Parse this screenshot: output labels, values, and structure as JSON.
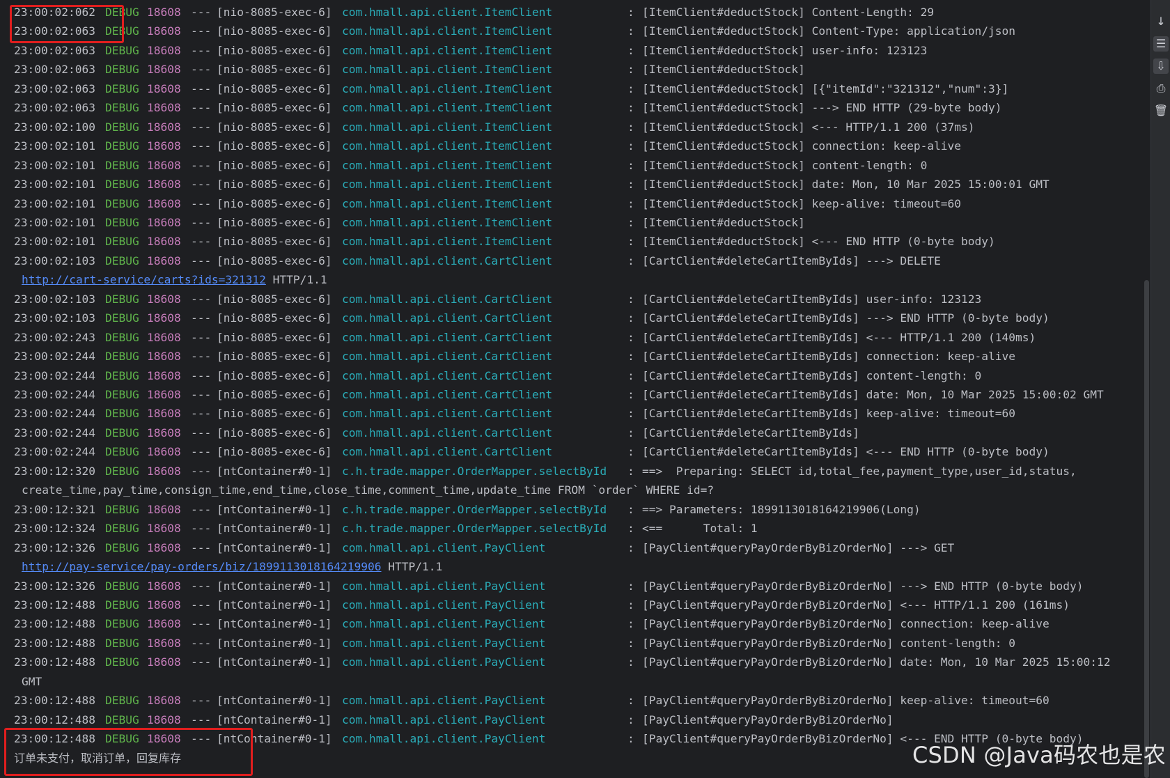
{
  "log_lines": [
    {
      "kind": "log",
      "ts": "23:00:02:062",
      "level": "DEBUG",
      "pid": "18608",
      "sep": "---",
      "thread": "[nio-8085-exec-6]",
      "logger": "com.hmall.api.client.ItemClient",
      "colon": ":",
      "message": "[ItemClient#deductStock] Content-Length: 29"
    },
    {
      "kind": "log",
      "ts": "23:00:02:063",
      "level": "DEBUG",
      "pid": "18608",
      "sep": "---",
      "thread": "[nio-8085-exec-6]",
      "logger": "com.hmall.api.client.ItemClient",
      "colon": ":",
      "message": "[ItemClient#deductStock] Content-Type: application/json"
    },
    {
      "kind": "log",
      "ts": "23:00:02:063",
      "level": "DEBUG",
      "pid": "18608",
      "sep": "---",
      "thread": "[nio-8085-exec-6]",
      "logger": "com.hmall.api.client.ItemClient",
      "colon": ":",
      "message": "[ItemClient#deductStock] user-info: 123123"
    },
    {
      "kind": "log",
      "ts": "23:00:02:063",
      "level": "DEBUG",
      "pid": "18608",
      "sep": "---",
      "thread": "[nio-8085-exec-6]",
      "logger": "com.hmall.api.client.ItemClient",
      "colon": ":",
      "message": "[ItemClient#deductStock]"
    },
    {
      "kind": "log",
      "ts": "23:00:02:063",
      "level": "DEBUG",
      "pid": "18608",
      "sep": "---",
      "thread": "[nio-8085-exec-6]",
      "logger": "com.hmall.api.client.ItemClient",
      "colon": ":",
      "message": "[ItemClient#deductStock] [{\"itemId\":\"321312\",\"num\":3}]"
    },
    {
      "kind": "log",
      "ts": "23:00:02:063",
      "level": "DEBUG",
      "pid": "18608",
      "sep": "---",
      "thread": "[nio-8085-exec-6]",
      "logger": "com.hmall.api.client.ItemClient",
      "colon": ":",
      "message": "[ItemClient#deductStock] ---> END HTTP (29-byte body)"
    },
    {
      "kind": "log",
      "ts": "23:00:02:100",
      "level": "DEBUG",
      "pid": "18608",
      "sep": "---",
      "thread": "[nio-8085-exec-6]",
      "logger": "com.hmall.api.client.ItemClient",
      "colon": ":",
      "message": "[ItemClient#deductStock] <--- HTTP/1.1 200 (37ms)"
    },
    {
      "kind": "log",
      "ts": "23:00:02:101",
      "level": "DEBUG",
      "pid": "18608",
      "sep": "---",
      "thread": "[nio-8085-exec-6]",
      "logger": "com.hmall.api.client.ItemClient",
      "colon": ":",
      "message": "[ItemClient#deductStock] connection: keep-alive"
    },
    {
      "kind": "log",
      "ts": "23:00:02:101",
      "level": "DEBUG",
      "pid": "18608",
      "sep": "---",
      "thread": "[nio-8085-exec-6]",
      "logger": "com.hmall.api.client.ItemClient",
      "colon": ":",
      "message": "[ItemClient#deductStock] content-length: 0"
    },
    {
      "kind": "log",
      "ts": "23:00:02:101",
      "level": "DEBUG",
      "pid": "18608",
      "sep": "---",
      "thread": "[nio-8085-exec-6]",
      "logger": "com.hmall.api.client.ItemClient",
      "colon": ":",
      "message": "[ItemClient#deductStock] date: Mon, 10 Mar 2025 15:00:01 GMT"
    },
    {
      "kind": "log",
      "ts": "23:00:02:101",
      "level": "DEBUG",
      "pid": "18608",
      "sep": "---",
      "thread": "[nio-8085-exec-6]",
      "logger": "com.hmall.api.client.ItemClient",
      "colon": ":",
      "message": "[ItemClient#deductStock] keep-alive: timeout=60"
    },
    {
      "kind": "log",
      "ts": "23:00:02:101",
      "level": "DEBUG",
      "pid": "18608",
      "sep": "---",
      "thread": "[nio-8085-exec-6]",
      "logger": "com.hmall.api.client.ItemClient",
      "colon": ":",
      "message": "[ItemClient#deductStock]"
    },
    {
      "kind": "log",
      "ts": "23:00:02:101",
      "level": "DEBUG",
      "pid": "18608",
      "sep": "---",
      "thread": "[nio-8085-exec-6]",
      "logger": "com.hmall.api.client.ItemClient",
      "colon": ":",
      "message": "[ItemClient#deductStock] <--- END HTTP (0-byte body)"
    },
    {
      "kind": "log",
      "ts": "23:00:02:103",
      "level": "DEBUG",
      "pid": "18608",
      "sep": "---",
      "thread": "[nio-8085-exec-6]",
      "logger": "com.hmall.api.client.CartClient",
      "colon": ":",
      "message": "[CartClient#deleteCartItemByIds] ---> DELETE"
    },
    {
      "kind": "url",
      "url": "http://cart-service/carts?ids=321312",
      "suffix": " HTTP/1.1"
    },
    {
      "kind": "log",
      "ts": "23:00:02:103",
      "level": "DEBUG",
      "pid": "18608",
      "sep": "---",
      "thread": "[nio-8085-exec-6]",
      "logger": "com.hmall.api.client.CartClient",
      "colon": ":",
      "message": "[CartClient#deleteCartItemByIds] user-info: 123123"
    },
    {
      "kind": "log",
      "ts": "23:00:02:103",
      "level": "DEBUG",
      "pid": "18608",
      "sep": "---",
      "thread": "[nio-8085-exec-6]",
      "logger": "com.hmall.api.client.CartClient",
      "colon": ":",
      "message": "[CartClient#deleteCartItemByIds] ---> END HTTP (0-byte body)"
    },
    {
      "kind": "log",
      "ts": "23:00:02:243",
      "level": "DEBUG",
      "pid": "18608",
      "sep": "---",
      "thread": "[nio-8085-exec-6]",
      "logger": "com.hmall.api.client.CartClient",
      "colon": ":",
      "message": "[CartClient#deleteCartItemByIds] <--- HTTP/1.1 200 (140ms)"
    },
    {
      "kind": "log",
      "ts": "23:00:02:244",
      "level": "DEBUG",
      "pid": "18608",
      "sep": "---",
      "thread": "[nio-8085-exec-6]",
      "logger": "com.hmall.api.client.CartClient",
      "colon": ":",
      "message": "[CartClient#deleteCartItemByIds] connection: keep-alive"
    },
    {
      "kind": "log",
      "ts": "23:00:02:244",
      "level": "DEBUG",
      "pid": "18608",
      "sep": "---",
      "thread": "[nio-8085-exec-6]",
      "logger": "com.hmall.api.client.CartClient",
      "colon": ":",
      "message": "[CartClient#deleteCartItemByIds] content-length: 0"
    },
    {
      "kind": "log",
      "ts": "23:00:02:244",
      "level": "DEBUG",
      "pid": "18608",
      "sep": "---",
      "thread": "[nio-8085-exec-6]",
      "logger": "com.hmall.api.client.CartClient",
      "colon": ":",
      "message": "[CartClient#deleteCartItemByIds] date: Mon, 10 Mar 2025 15:00:02 GMT"
    },
    {
      "kind": "log",
      "ts": "23:00:02:244",
      "level": "DEBUG",
      "pid": "18608",
      "sep": "---",
      "thread": "[nio-8085-exec-6]",
      "logger": "com.hmall.api.client.CartClient",
      "colon": ":",
      "message": "[CartClient#deleteCartItemByIds] keep-alive: timeout=60"
    },
    {
      "kind": "log",
      "ts": "23:00:02:244",
      "level": "DEBUG",
      "pid": "18608",
      "sep": "---",
      "thread": "[nio-8085-exec-6]",
      "logger": "com.hmall.api.client.CartClient",
      "colon": ":",
      "message": "[CartClient#deleteCartItemByIds]"
    },
    {
      "kind": "log",
      "ts": "23:00:02:244",
      "level": "DEBUG",
      "pid": "18608",
      "sep": "---",
      "thread": "[nio-8085-exec-6]",
      "logger": "com.hmall.api.client.CartClient",
      "colon": ":",
      "message": "[CartClient#deleteCartItemByIds] <--- END HTTP (0-byte body)"
    },
    {
      "kind": "log",
      "ts": "23:00:12:320",
      "level": "DEBUG",
      "pid": "18608",
      "sep": "---",
      "thread": "[ntContainer#0-1]",
      "logger": "c.h.trade.mapper.OrderMapper.selectById",
      "colon": ":",
      "message": "==>  Preparing: SELECT id,total_fee,payment_type,user_id,status,"
    },
    {
      "kind": "cont",
      "text": "create_time,pay_time,consign_time,end_time,close_time,comment_time,update_time FROM `order` WHERE id=?"
    },
    {
      "kind": "log",
      "ts": "23:00:12:321",
      "level": "DEBUG",
      "pid": "18608",
      "sep": "---",
      "thread": "[ntContainer#0-1]",
      "logger": "c.h.trade.mapper.OrderMapper.selectById",
      "colon": ":",
      "message": "==> Parameters: 1899113018164219906(Long)"
    },
    {
      "kind": "log",
      "ts": "23:00:12:324",
      "level": "DEBUG",
      "pid": "18608",
      "sep": "---",
      "thread": "[ntContainer#0-1]",
      "logger": "c.h.trade.mapper.OrderMapper.selectById",
      "colon": ":",
      "message": "<==      Total: 1"
    },
    {
      "kind": "log",
      "ts": "23:00:12:326",
      "level": "DEBUG",
      "pid": "18608",
      "sep": "---",
      "thread": "[ntContainer#0-1]",
      "logger": "com.hmall.api.client.PayClient",
      "colon": ":",
      "message": "[PayClient#queryPayOrderByBizOrderNo] ---> GET"
    },
    {
      "kind": "url",
      "url": "http://pay-service/pay-orders/biz/1899113018164219906",
      "suffix": " HTTP/1.1"
    },
    {
      "kind": "log",
      "ts": "23:00:12:326",
      "level": "DEBUG",
      "pid": "18608",
      "sep": "---",
      "thread": "[ntContainer#0-1]",
      "logger": "com.hmall.api.client.PayClient",
      "colon": ":",
      "message": "[PayClient#queryPayOrderByBizOrderNo] ---> END HTTP (0-byte body)"
    },
    {
      "kind": "log",
      "ts": "23:00:12:488",
      "level": "DEBUG",
      "pid": "18608",
      "sep": "---",
      "thread": "[ntContainer#0-1]",
      "logger": "com.hmall.api.client.PayClient",
      "colon": ":",
      "message": "[PayClient#queryPayOrderByBizOrderNo] <--- HTTP/1.1 200 (161ms)"
    },
    {
      "kind": "log",
      "ts": "23:00:12:488",
      "level": "DEBUG",
      "pid": "18608",
      "sep": "---",
      "thread": "[ntContainer#0-1]",
      "logger": "com.hmall.api.client.PayClient",
      "colon": ":",
      "message": "[PayClient#queryPayOrderByBizOrderNo] connection: keep-alive"
    },
    {
      "kind": "log",
      "ts": "23:00:12:488",
      "level": "DEBUG",
      "pid": "18608",
      "sep": "---",
      "thread": "[ntContainer#0-1]",
      "logger": "com.hmall.api.client.PayClient",
      "colon": ":",
      "message": "[PayClient#queryPayOrderByBizOrderNo] content-length: 0"
    },
    {
      "kind": "log",
      "ts": "23:00:12:488",
      "level": "DEBUG",
      "pid": "18608",
      "sep": "---",
      "thread": "[ntContainer#0-1]",
      "logger": "com.hmall.api.client.PayClient",
      "colon": ":",
      "message": "[PayClient#queryPayOrderByBizOrderNo] date: Mon, 10 Mar 2025 15:00:12"
    },
    {
      "kind": "cont",
      "text": "GMT"
    },
    {
      "kind": "log",
      "ts": "23:00:12:488",
      "level": "DEBUG",
      "pid": "18608",
      "sep": "---",
      "thread": "[ntContainer#0-1]",
      "logger": "com.hmall.api.client.PayClient",
      "colon": ":",
      "message": "[PayClient#queryPayOrderByBizOrderNo] keep-alive: timeout=60"
    },
    {
      "kind": "log",
      "ts": "23:00:12:488",
      "level": "DEBUG",
      "pid": "18608",
      "sep": "---",
      "thread": "[ntContainer#0-1]",
      "logger": "com.hmall.api.client.PayClient",
      "colon": ":",
      "message": "[PayClient#queryPayOrderByBizOrderNo]"
    },
    {
      "kind": "log",
      "ts": "23:00:12:488",
      "level": "DEBUG",
      "pid": "18608",
      "sep": "---",
      "thread": "[ntContainer#0-1]",
      "logger": "com.hmall.api.client.PayClient",
      "colon": ":",
      "message": "[PayClient#queryPayOrderByBizOrderNo] <--- END HTTP (0-byte body)"
    },
    {
      "kind": "plain",
      "text": "订单未支付，取消订单，回复库存"
    }
  ],
  "watermark": "CSDN @Java码农也是农",
  "toolbar": [
    {
      "name": "scroll-to-end-icon",
      "glyph": "↓"
    },
    {
      "name": "soft-wrap-icon",
      "glyph": "☰"
    },
    {
      "name": "scroll-to-end-toggle-icon",
      "glyph": "⇩"
    },
    {
      "name": "print-icon",
      "glyph": "⎙"
    },
    {
      "name": "clear-all-icon",
      "glyph": "🗑"
    }
  ],
  "colors": {
    "background": "#1e1f22",
    "text": "#bcbec4",
    "level_debug": "#5fb34b",
    "pid": "#c77dbb",
    "logger": "#2aacb8",
    "link": "#548af7",
    "highlight": "#e01e1e"
  }
}
